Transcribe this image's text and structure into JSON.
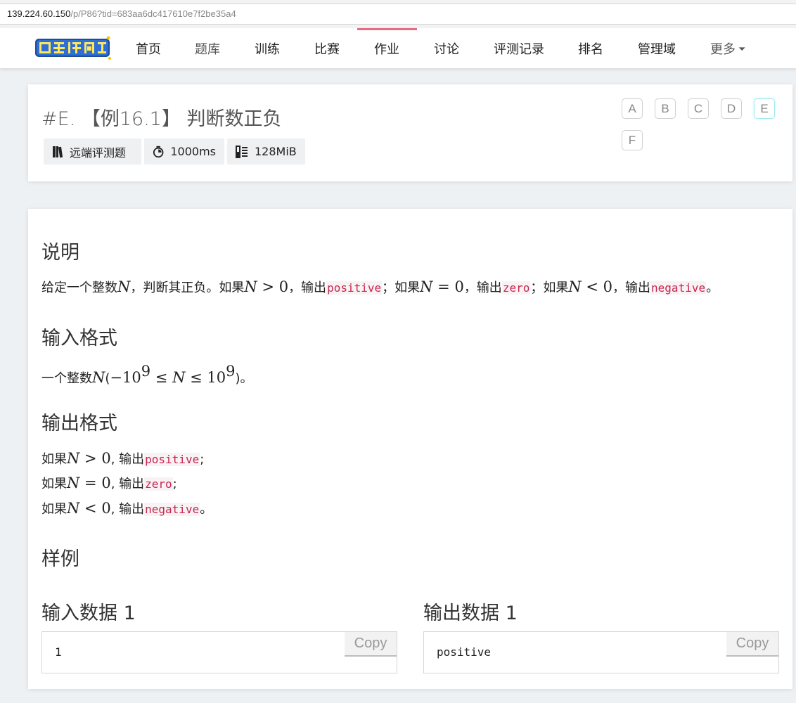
{
  "browser": {
    "url_host": "139.224.60.150",
    "url_path": "/p/P86?tid=683aa6dc417610e7f2be35a4"
  },
  "nav": {
    "logo_text": "吴老师同学",
    "items": [
      "首页",
      "题库",
      "训练",
      "比赛",
      "作业",
      "讨论",
      "评测记录",
      "排名",
      "管理域",
      "更多"
    ],
    "active_index": 4,
    "more_chevron": "⌄"
  },
  "problem": {
    "title": "#E. 【例16.1】 判断数正负",
    "badges": {
      "type": "远端评测题",
      "time": "1000ms",
      "memory": "128MiB"
    },
    "letters": [
      "A",
      "B",
      "C",
      "D",
      "E",
      "F"
    ],
    "active_letter": "E"
  },
  "content": {
    "desc_heading": "说明",
    "desc": {
      "t1": "给定一个整数",
      "N": "N",
      "t2": "，判断其正负。如果",
      "gt0": " > 0",
      "t3": "，输出",
      "positive": "positive",
      "t4": "；如果",
      "eq0": " = 0",
      "t5": "，输出",
      "zero": "zero",
      "t6": "；如果",
      "lt0": " < 0",
      "t7": "，输出",
      "negative": "negative",
      "t8": "。"
    },
    "input_heading": "输入格式",
    "input": {
      "t1": "一个整数",
      "N": "N",
      "open": "(",
      "neg10": "−10",
      "exp": "9",
      "le1": " ≤ ",
      "N2": "N",
      "le2": " ≤ ",
      "ten": "10",
      "exp2": "9",
      "close": ")",
      "end": "。"
    },
    "output_heading": "输出格式",
    "output_lines": [
      {
        "pre": "如果",
        "N": "N",
        "op": " > 0",
        "mid": ", 输出",
        "code": "positive",
        "end": ";"
      },
      {
        "pre": "如果",
        "N": "N",
        "op": " = 0",
        "mid": ", 输出",
        "code": "zero",
        "end": ";"
      },
      {
        "pre": "如果",
        "N": "N",
        "op": " < 0",
        "mid": ", 输出",
        "code": "negative",
        "end": "。"
      }
    ],
    "samples_heading": "样例",
    "samples": {
      "input_label": "输入数据 1",
      "input_value": "1",
      "output_label": "输出数据 1",
      "output_value": "positive",
      "copy_label": "Copy"
    }
  }
}
